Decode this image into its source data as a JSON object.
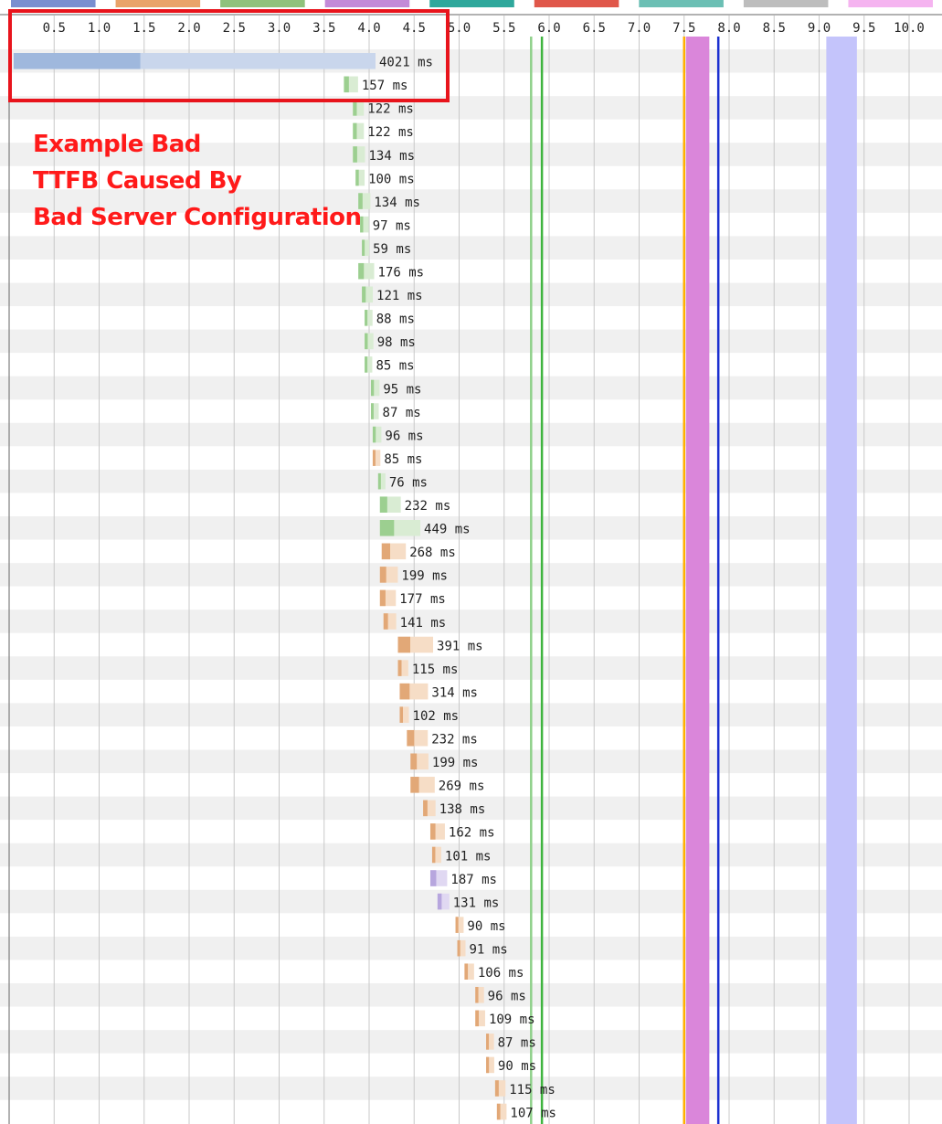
{
  "legend_colors": [
    "#7a8fd0",
    "#e9a36a",
    "#8fc27c",
    "#c38ad8",
    "#2fa89c",
    "#e0574a",
    "#6bbfb4",
    "#bdbdbd",
    "#f5b4f0"
  ],
  "annotation": {
    "lines": [
      "Example Bad",
      "TTFB Caused By",
      "Bad Server Configuration"
    ],
    "color": "#ff1a1a"
  },
  "chart_data": {
    "type": "waterfall",
    "x_ticks": [
      "0.5",
      "1.0",
      "1.5",
      "2.0",
      "2.5",
      "3.0",
      "3.5",
      "4.0",
      "4.5",
      "5.0",
      "5.5",
      "6.0",
      "6.5",
      "7.0",
      "7.5",
      "8.0",
      "8.5",
      "9.0",
      "9.5",
      "10.0"
    ],
    "xlim": [
      0,
      10.2
    ],
    "x_unit": "seconds",
    "markers": [
      {
        "time": 5.8,
        "color": "#8fd08a"
      },
      {
        "time": 5.92,
        "color": "#3fb43f"
      },
      {
        "time": 7.5,
        "color": "#ffb000"
      },
      {
        "time": 7.88,
        "color": "#1b2fd0"
      }
    ],
    "bands": [
      {
        "start": 7.52,
        "end": 7.78,
        "color": "#da86da"
      },
      {
        "start": 9.08,
        "end": 9.42,
        "color": "#c4c4fb"
      }
    ],
    "requests": [
      {
        "start": 0.05,
        "duration_ms": 4021,
        "label": "4021 ms",
        "type": "blue"
      },
      {
        "start": 3.72,
        "duration_ms": 157,
        "label": "157 ms",
        "type": "green"
      },
      {
        "start": 3.82,
        "duration_ms": 122,
        "label": "122 ms",
        "type": "green"
      },
      {
        "start": 3.82,
        "duration_ms": 122,
        "label": "122 ms",
        "type": "green"
      },
      {
        "start": 3.82,
        "duration_ms": 134,
        "label": "134 ms",
        "type": "green"
      },
      {
        "start": 3.85,
        "duration_ms": 100,
        "label": "100 ms",
        "type": "green"
      },
      {
        "start": 3.88,
        "duration_ms": 134,
        "label": "134 ms",
        "type": "green"
      },
      {
        "start": 3.9,
        "duration_ms": 97,
        "label": "97 ms",
        "type": "green"
      },
      {
        "start": 3.92,
        "duration_ms": 59,
        "label": "59 ms",
        "type": "green"
      },
      {
        "start": 3.88,
        "duration_ms": 176,
        "label": "176 ms",
        "type": "green"
      },
      {
        "start": 3.92,
        "duration_ms": 121,
        "label": "121 ms",
        "type": "green"
      },
      {
        "start": 3.95,
        "duration_ms": 88,
        "label": "88 ms",
        "type": "green"
      },
      {
        "start": 3.95,
        "duration_ms": 98,
        "label": "98 ms",
        "type": "green"
      },
      {
        "start": 3.95,
        "duration_ms": 85,
        "label": "85 ms",
        "type": "green"
      },
      {
        "start": 4.02,
        "duration_ms": 95,
        "label": "95 ms",
        "type": "green"
      },
      {
        "start": 4.02,
        "duration_ms": 87,
        "label": "87 ms",
        "type": "green"
      },
      {
        "start": 4.04,
        "duration_ms": 96,
        "label": "96 ms",
        "type": "green"
      },
      {
        "start": 4.04,
        "duration_ms": 85,
        "label": "85 ms",
        "type": "orange"
      },
      {
        "start": 4.1,
        "duration_ms": 76,
        "label": "76 ms",
        "type": "green"
      },
      {
        "start": 4.12,
        "duration_ms": 232,
        "label": "232 ms",
        "type": "green"
      },
      {
        "start": 4.12,
        "duration_ms": 449,
        "label": "449 ms",
        "type": "green"
      },
      {
        "start": 4.14,
        "duration_ms": 268,
        "label": "268 ms",
        "type": "orange"
      },
      {
        "start": 4.12,
        "duration_ms": 199,
        "label": "199 ms",
        "type": "orange"
      },
      {
        "start": 4.12,
        "duration_ms": 177,
        "label": "177 ms",
        "type": "orange"
      },
      {
        "start": 4.16,
        "duration_ms": 141,
        "label": "141 ms",
        "type": "orange"
      },
      {
        "start": 4.32,
        "duration_ms": 391,
        "label": "391 ms",
        "type": "orange"
      },
      {
        "start": 4.32,
        "duration_ms": 115,
        "label": "115 ms",
        "type": "orange"
      },
      {
        "start": 4.34,
        "duration_ms": 314,
        "label": "314 ms",
        "type": "orange"
      },
      {
        "start": 4.34,
        "duration_ms": 102,
        "label": "102 ms",
        "type": "orange"
      },
      {
        "start": 4.42,
        "duration_ms": 232,
        "label": "232 ms",
        "type": "orange"
      },
      {
        "start": 4.46,
        "duration_ms": 199,
        "label": "199 ms",
        "type": "orange"
      },
      {
        "start": 4.46,
        "duration_ms": 269,
        "label": "269 ms",
        "type": "orange"
      },
      {
        "start": 4.6,
        "duration_ms": 138,
        "label": "138 ms",
        "type": "orange"
      },
      {
        "start": 4.68,
        "duration_ms": 162,
        "label": "162 ms",
        "type": "orange"
      },
      {
        "start": 4.7,
        "duration_ms": 101,
        "label": "101 ms",
        "type": "orange"
      },
      {
        "start": 4.68,
        "duration_ms": 187,
        "label": "187 ms",
        "type": "purple"
      },
      {
        "start": 4.76,
        "duration_ms": 131,
        "label": "131 ms",
        "type": "purple"
      },
      {
        "start": 4.96,
        "duration_ms": 90,
        "label": "90 ms",
        "type": "orange"
      },
      {
        "start": 4.98,
        "duration_ms": 91,
        "label": "91 ms",
        "type": "orange"
      },
      {
        "start": 5.06,
        "duration_ms": 106,
        "label": "106 ms",
        "type": "orange"
      },
      {
        "start": 5.18,
        "duration_ms": 96,
        "label": "96 ms",
        "type": "orange"
      },
      {
        "start": 5.18,
        "duration_ms": 109,
        "label": "109 ms",
        "type": "orange"
      },
      {
        "start": 5.3,
        "duration_ms": 87,
        "label": "87 ms",
        "type": "orange"
      },
      {
        "start": 5.3,
        "duration_ms": 90,
        "label": "90 ms",
        "type": "orange"
      },
      {
        "start": 5.4,
        "duration_ms": 115,
        "label": "115 ms",
        "type": "orange"
      },
      {
        "start": 5.42,
        "duration_ms": 107,
        "label": "107 ms",
        "type": "orange"
      }
    ]
  }
}
